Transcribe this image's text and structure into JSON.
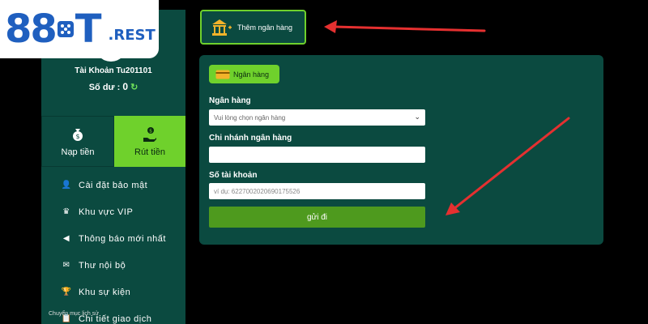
{
  "logo": {
    "num": "88",
    "t": "T",
    "suffix": ".REST"
  },
  "sidebar": {
    "account_name": "Tài Khoản Tu201101",
    "balance_label": "Số dư :",
    "balance_value": "0",
    "deposit_label": "Nạp tiền",
    "withdraw_label": "Rút tiền",
    "menu": [
      {
        "label": "Cài đặt bảo mật",
        "icon": "user-lock-icon"
      },
      {
        "label": "Khu vực VIP",
        "icon": "crown-icon"
      },
      {
        "label": "Thông báo mới nhất",
        "icon": "megaphone-icon"
      },
      {
        "label": "Thư nội bộ",
        "icon": "envelope-icon"
      },
      {
        "label": "Khu sự kiện",
        "icon": "trophy-icon"
      },
      {
        "label": "Chi tiết giao dịch",
        "icon": "clipboard-icon"
      }
    ],
    "cut_text": "Chuyển mục lịch sử"
  },
  "add_bank": {
    "label": "Thêm ngân hàng"
  },
  "form": {
    "tab_label": "Ngân hàng",
    "bank_label": "Ngân hàng",
    "bank_select_value": "Vui lòng chọn ngân hàng",
    "branch_label": "Chi nhánh ngân hàng",
    "branch_value": "",
    "account_label": "Số tài khoản",
    "account_placeholder": "ví dụ:  6227002020690175526",
    "submit_label": "gửi đi"
  },
  "colors": {
    "sidebar_bg": "#0b4a40",
    "accent_green": "#6fd12c",
    "arrow_red": "#e53030",
    "logo_blue": "#1f5fbf"
  }
}
